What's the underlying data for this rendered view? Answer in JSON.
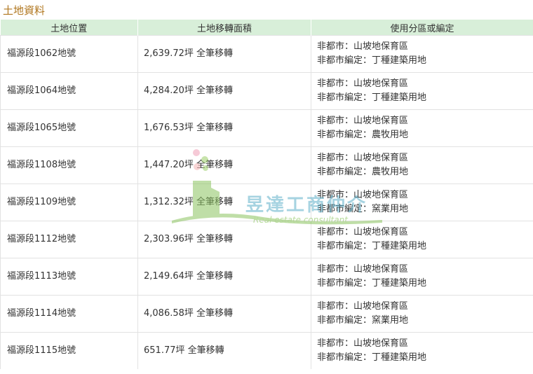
{
  "section": {
    "title": "土地資料"
  },
  "table": {
    "headers": [
      "土地位置",
      "土地移轉面積",
      "使用分區或編定"
    ],
    "rows": [
      {
        "location": "福源段1062地號",
        "area": "2,639.72坪 全筆移轉",
        "zone_line1": "非都市：山坡地保育區",
        "zone_line2": "非都市編定：丁種建築用地"
      },
      {
        "location": "福源段1064地號",
        "area": "4,284.20坪 全筆移轉",
        "zone_line1": "非都市：山坡地保育區",
        "zone_line2": "非都市編定：丁種建築用地"
      },
      {
        "location": "福源段1065地號",
        "area": "1,676.53坪 全筆移轉",
        "zone_line1": "非都市：山坡地保育區",
        "zone_line2": "非都市編定：農牧用地"
      },
      {
        "location": "福源段1108地號",
        "area": "1,447.20坪 全筆移轉",
        "zone_line1": "非都市：山坡地保育區",
        "zone_line2": "非都市編定：農牧用地"
      },
      {
        "location": "福源段1109地號",
        "area": "1,312.32坪 全筆移轉",
        "zone_line1": "非都市：山坡地保育區",
        "zone_line2": "非都市編定：窯業用地"
      },
      {
        "location": "福源段1112地號",
        "area": "2,303.96坪 全筆移轉",
        "zone_line1": "非都市：山坡地保育區",
        "zone_line2": "非都市編定：丁種建築用地"
      },
      {
        "location": "福源段1113地號",
        "area": "2,149.64坪 全筆移轉",
        "zone_line1": "非都市：山坡地保育區",
        "zone_line2": "非都市編定：丁種建築用地"
      },
      {
        "location": "福源段1114地號",
        "area": "4,086.58坪 全筆移轉",
        "zone_line1": "非都市：山坡地保育區",
        "zone_line2": "非都市編定：窯業用地"
      },
      {
        "location": "福源段1115地號",
        "area": "651.77坪 全筆移轉",
        "zone_line1": "非都市：山坡地保育區",
        "zone_line2": "非都市編定：丁種建築用地"
      }
    ]
  },
  "watermark": {
    "text": "昱達工商仲介",
    "subtext": "Real estate consultant"
  },
  "colors": {
    "title": "#b0761e",
    "header_bg": "#d8efd9",
    "border": "#e2e2e2",
    "watermark_text": "#5fb0c9",
    "watermark_green": "#7fbf4d"
  }
}
